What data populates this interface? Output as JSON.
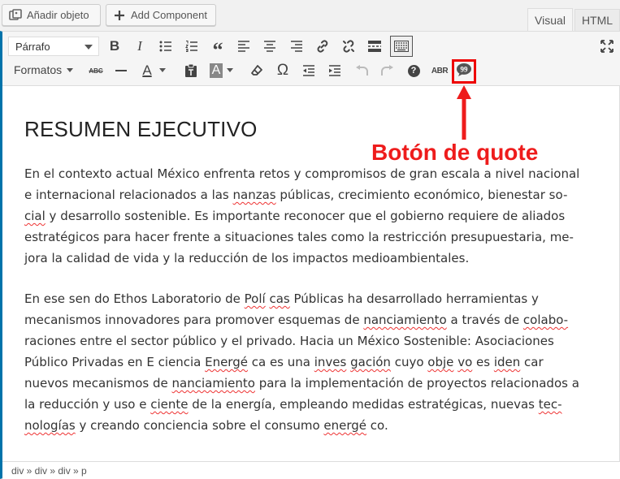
{
  "top_buttons": {
    "add_object_label": "Añadir objeto",
    "add_component_label": "Add Component"
  },
  "tabs": {
    "visual": "Visual",
    "html": "HTML"
  },
  "toolbar": {
    "format_select": "Párrafo",
    "formats_label": "Formatos",
    "row1_icons": [
      "bold-icon",
      "italic-icon",
      "bullet-list-icon",
      "numbered-list-icon",
      "blockquote-icon",
      "align-left-icon",
      "align-center-icon",
      "align-right-icon",
      "link-icon",
      "unlink-icon",
      "read-more-icon",
      "toolbar-toggle-icon",
      "fullscreen-icon"
    ],
    "row2_icons": [
      "strikethrough-icon",
      "horizontal-line-icon",
      "text-color-icon",
      "paste-text-icon",
      "background-color-icon",
      "clear-formatting-icon",
      "special-character-icon",
      "outdent-icon",
      "indent-icon",
      "undo-icon",
      "redo-icon",
      "help-icon",
      "abbreviation-icon",
      "quote-icon"
    ],
    "bold": "B",
    "italic": "I",
    "quote_marks": "“",
    "text_color": "A",
    "background_color": "A",
    "omega": "Ω",
    "help": "?",
    "strikethrough": "ABC",
    "abbreviation": "ABR"
  },
  "annotation": {
    "text": "Botón de quote",
    "color": "#ee1c1c"
  },
  "content": {
    "heading": "RESUMEN EJECUTIVO",
    "p1_lines": [
      [
        "En el contexto actual México enfrenta retos y compromisos de gran escala a nivel nacional"
      ],
      [
        "e internacional relacionados a las ",
        {
          "sp": "nanzas"
        },
        " públicas, crecimiento económico, bienestar so-"
      ],
      [
        {
          "sp": "cial"
        },
        " y desarrollo sostenible. Es importante reconocer que el gobierno requiere de aliados"
      ],
      [
        "estratégicos para hacer frente a situaciones tales como la restricción presupuestaria, me-"
      ],
      [
        "jora la calidad de vida y la reducción de los impactos medioambientales."
      ]
    ],
    "p2_lines": [
      [
        "En ese sen do Ethos Laboratorio de ",
        {
          "sp": "Polí"
        },
        " ",
        {
          "sp": "cas"
        },
        " Públicas ha desarrollado herramientas y"
      ],
      [
        "mecanismos innovadores para promover esquemas de ",
        {
          "sp": "nanciamiento"
        },
        " a través de ",
        {
          "sp": "colabo-"
        }
      ],
      [
        "raciones entre el sector público y el privado. Hacia un México Sostenible: Asociaciones"
      ],
      [
        "Público Privadas en E ciencia ",
        {
          "sp": "Energé"
        },
        " ca es una ",
        {
          "sp": "inves"
        },
        " ",
        {
          "sp": "gación"
        },
        " cuyo ",
        {
          "sp": "obje"
        },
        " ",
        {
          "sp": "vo"
        },
        " es ",
        {
          "sp": "iden"
        },
        " car"
      ],
      [
        "nuevos mecanismos de ",
        {
          "sp": "nanciamiento"
        },
        " para la implementación de proyectos relacionados a"
      ],
      [
        "la reducción y uso e ",
        {
          "sp": "ciente"
        },
        " de la energía, empleando medidas estratégicas, nuevas ",
        {
          "sp": "tec-"
        }
      ],
      [
        {
          "sp": "nologías"
        },
        " y creando conciencia sobre el consumo ",
        {
          "sp": "energé"
        },
        " co."
      ]
    ]
  },
  "statusbar": {
    "path": "div » div » div » p"
  },
  "colors": {
    "accent": "#0073aa",
    "highlight": "#ee1c1c"
  }
}
